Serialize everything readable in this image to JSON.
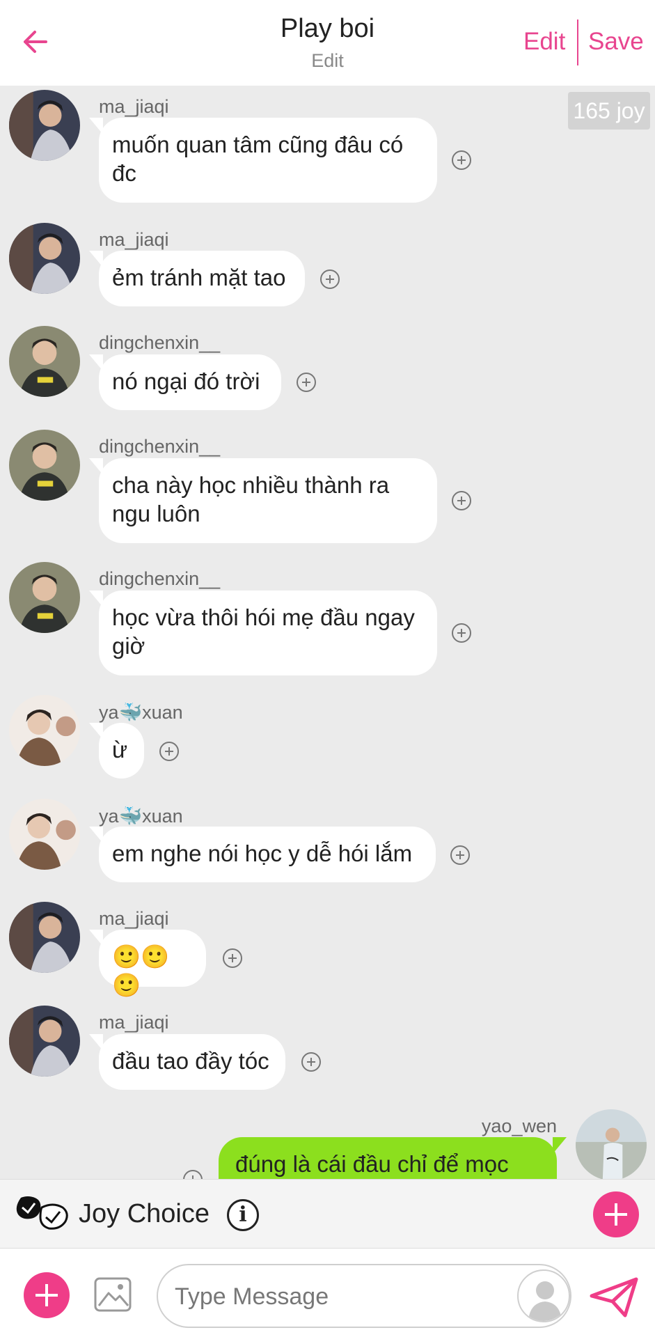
{
  "header": {
    "back_icon": "arrow-left-icon",
    "title": "Play boi",
    "subtitle": "Edit",
    "edit_label": "Edit",
    "save_label": "Save",
    "accent_color": "#e8458f"
  },
  "joy_badge": "165 joy",
  "messages": [
    {
      "user": "ma_jiaqi",
      "text": "muốn quan tâm cũng đâu có\nđc"
    },
    {
      "user": "ma_jiaqi",
      "text": "ẻm tránh mặt tao"
    },
    {
      "user": "dingchenxin__",
      "text": "nó ngại đó trời"
    },
    {
      "user": "dingchenxin__",
      "text": "cha này học nhiều thành ra\nngu luôn"
    },
    {
      "user": "dingchenxin__",
      "text": "học vừa thôi hói mẹ đầu ngay\ngiờ"
    },
    {
      "user": "ya🐳xuan",
      "text": "ừ"
    },
    {
      "user": "ya🐳xuan",
      "text": "em nghe nói học y dễ hói lắm"
    },
    {
      "user": "ma_jiaqi",
      "text": "🙂🙂🙂"
    },
    {
      "user": "ma_jiaqi",
      "text": "đầu tao đầy tóc"
    },
    {
      "user": "yao_wen",
      "text": "đúng là cái đầu chỉ để mọc",
      "outgoing": true
    }
  ],
  "joy_choice": {
    "label": "Joy Choice",
    "info_symbol": "i"
  },
  "input": {
    "placeholder": "Type Message",
    "value": ""
  },
  "colors": {
    "outgoing_bubble": "#8cdf1e",
    "pink_button": "#ef3d88",
    "background": "#ebebeb"
  }
}
